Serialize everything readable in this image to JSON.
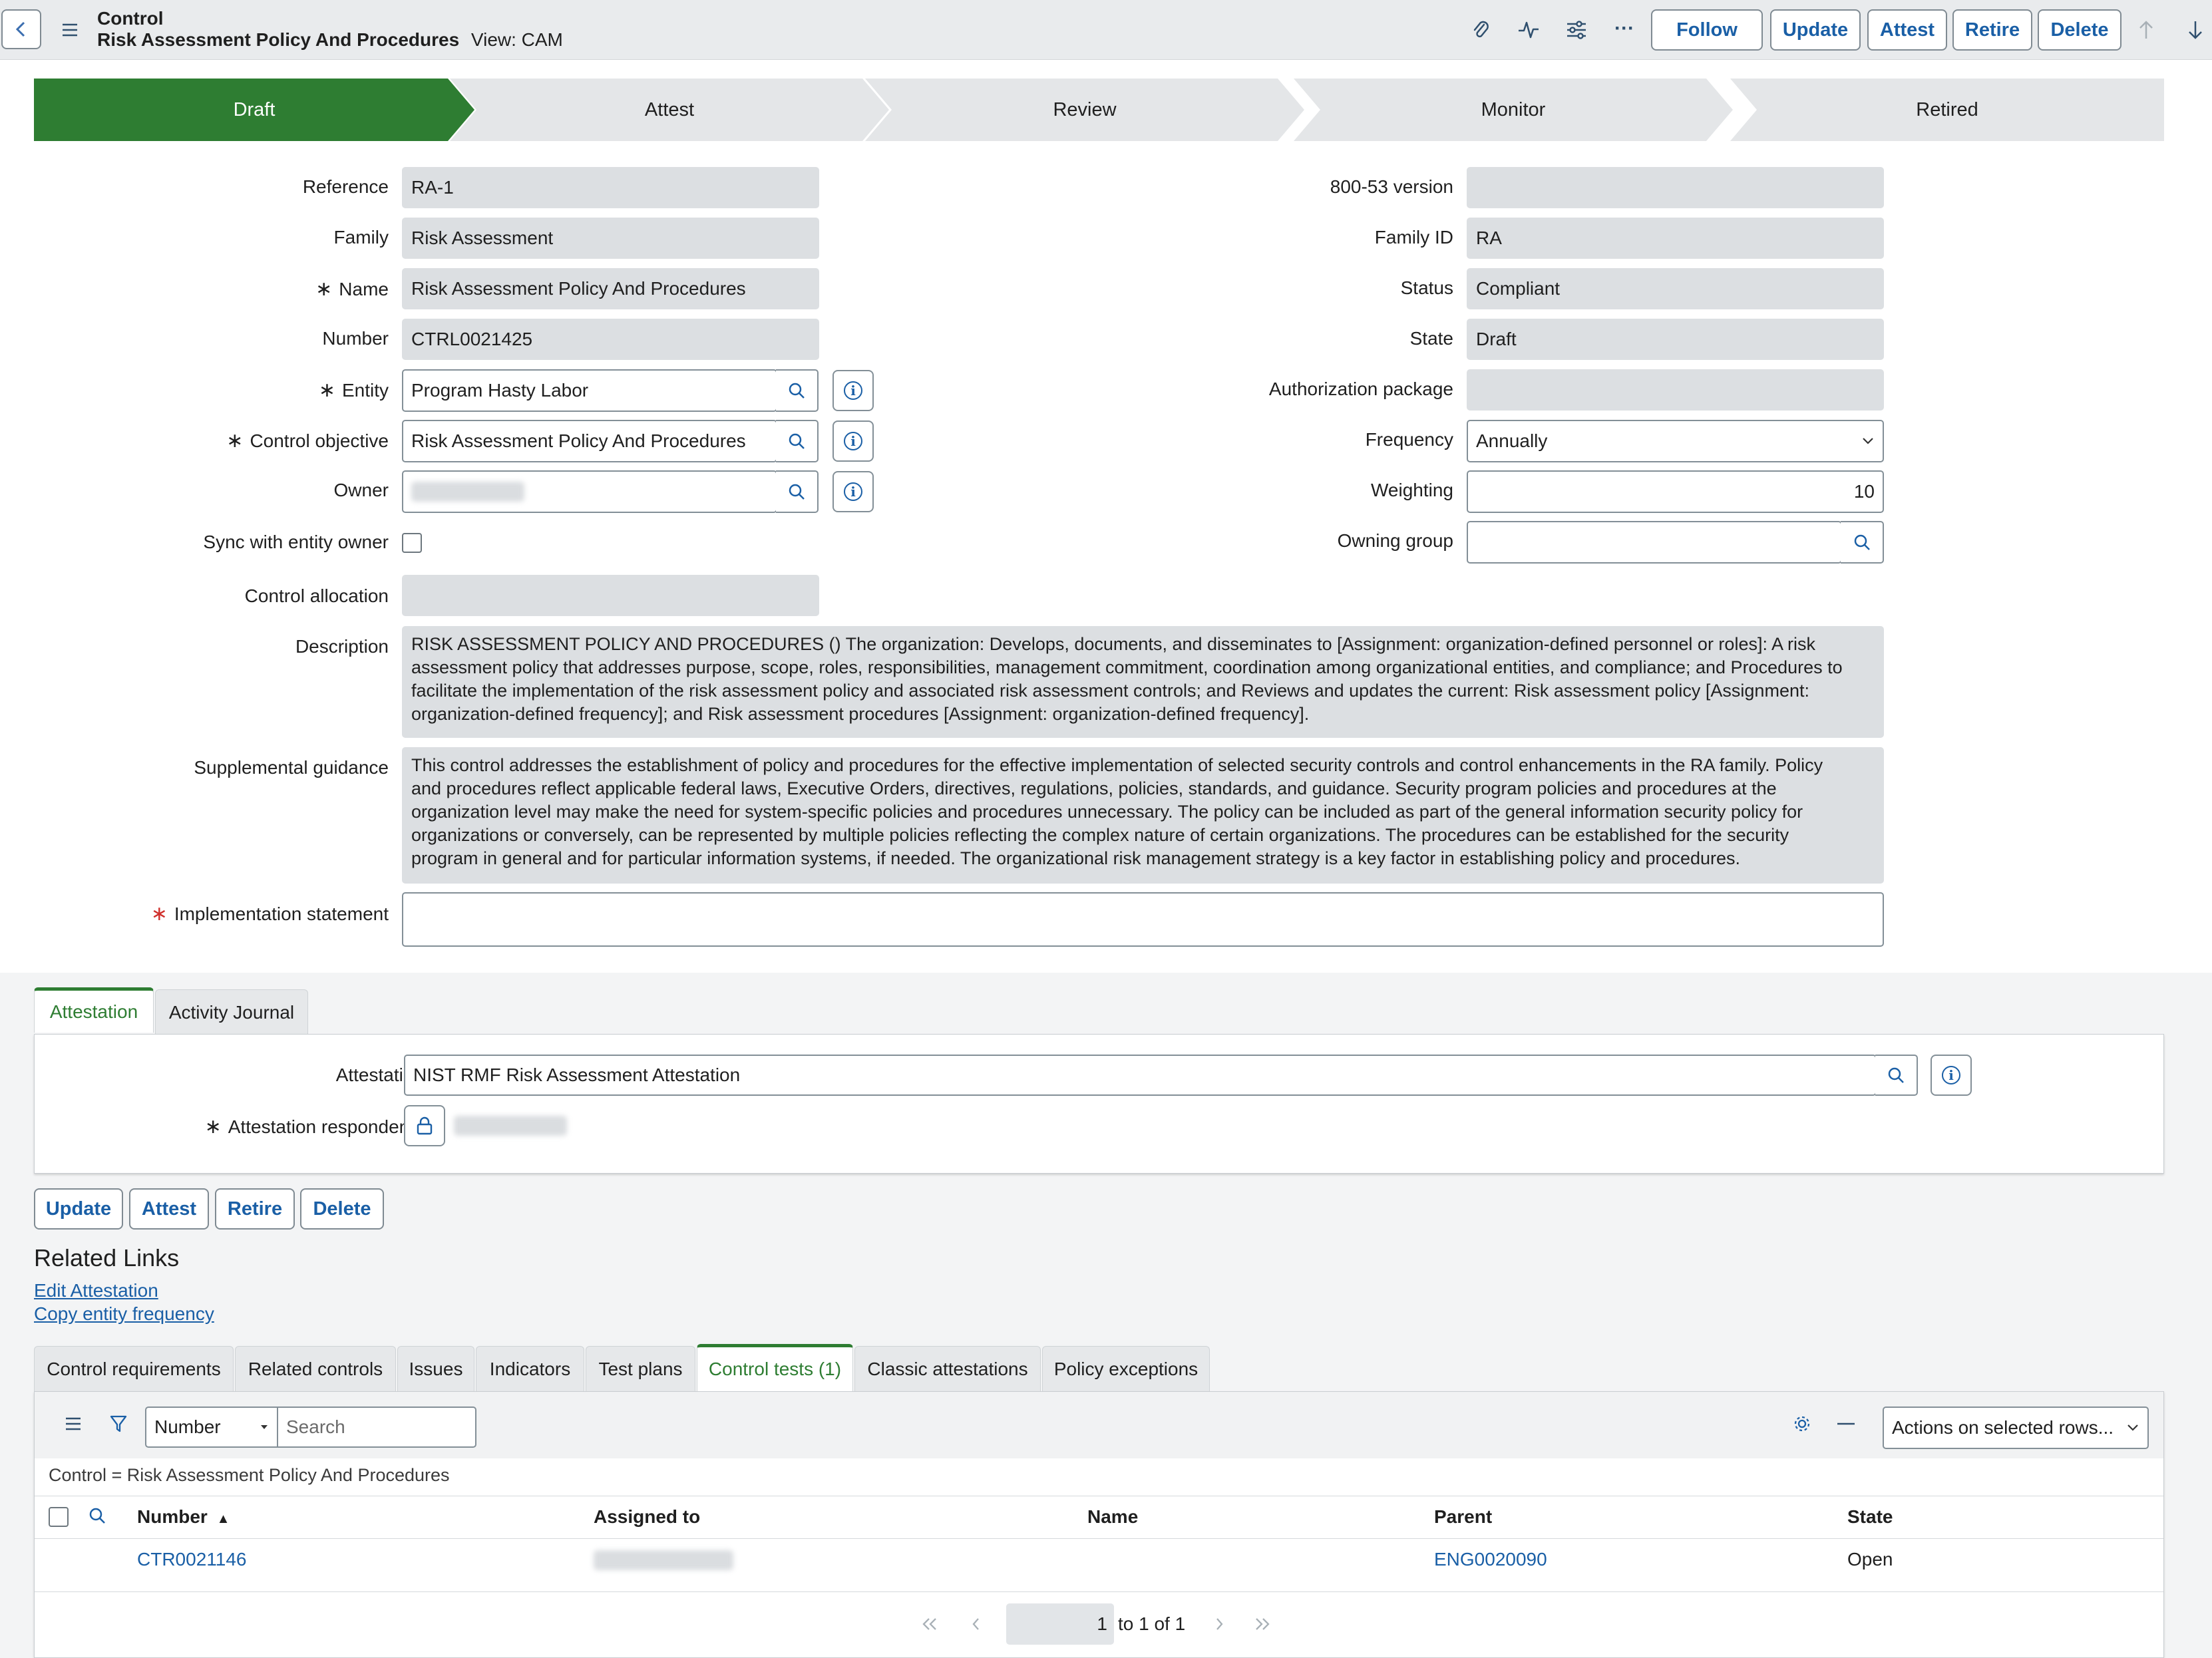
{
  "header": {
    "title": "Control",
    "record_name": "Risk Assessment Policy And Procedures",
    "view": "View: CAM",
    "buttons": {
      "follow": "Follow",
      "update": "Update",
      "attest": "Attest",
      "retire": "Retire",
      "delete": "Delete"
    },
    "more": "···"
  },
  "progress": {
    "stages": [
      "Draft",
      "Attest",
      "Review",
      "Monitor",
      "Retired"
    ],
    "active": "Draft",
    "active_color": "#2e7d32"
  },
  "form": {
    "reference": {
      "label": "Reference",
      "value": "RA-1"
    },
    "family": {
      "label": "Family",
      "value": "Risk Assessment"
    },
    "name": {
      "label": "Name",
      "value": "Risk Assessment Policy And Procedures"
    },
    "number": {
      "label": "Number",
      "value": "CTRL0021425"
    },
    "entity": {
      "label": "Entity",
      "value": "Program Hasty Labor"
    },
    "control_objective": {
      "label": "Control objective",
      "value": "Risk Assessment Policy And Procedures"
    },
    "owner": {
      "label": "Owner",
      "value": ""
    },
    "sync_owner": {
      "label": "Sync with entity owner",
      "checked": false
    },
    "control_allocation": {
      "label": "Control allocation",
      "value": ""
    },
    "version_80053": {
      "label": "800-53 version",
      "value": ""
    },
    "family_id": {
      "label": "Family ID",
      "value": "RA"
    },
    "status": {
      "label": "Status",
      "value": "Compliant"
    },
    "state": {
      "label": "State",
      "value": "Draft"
    },
    "authorization_package": {
      "label": "Authorization package",
      "value": ""
    },
    "frequency": {
      "label": "Frequency",
      "value": "Annually"
    },
    "weighting": {
      "label": "Weighting",
      "value": "10"
    },
    "owning_group": {
      "label": "Owning group",
      "value": ""
    },
    "description": {
      "label": "Description",
      "lines": [
        "RISK ASSESSMENT POLICY AND PROCEDURES () The organization: Develops, documents, and disseminates to [Assignment: organization-defined personnel or roles]: A risk",
        "assessment policy that addresses purpose, scope, roles, responsibilities, management commitment, coordination among organizational entities, and compliance; and Procedures to",
        "facilitate the implementation of the risk assessment policy and associated risk assessment controls; and Reviews and updates the current: Risk assessment policy [Assignment:",
        "organization-defined frequency]; and Risk assessment procedures [Assignment: organization-defined frequency]."
      ]
    },
    "supplemental_guidance": {
      "label": "Supplemental guidance",
      "lines": [
        "This control addresses the establishment of policy and procedures for the effective implementation of selected security controls and control enhancements in the RA family. Policy",
        "and procedures reflect applicable federal laws, Executive Orders, directives, regulations, policies, standards, and guidance. Security program policies and procedures at the",
        "organization level may make the need for system-specific policies and procedures unnecessary. The policy can be included as part of the general information security policy for",
        "organizations or conversely, can be represented by multiple policies reflecting the complex nature of certain organizations. The procedures can be established for the security",
        "program in general and for particular information systems, if needed. The organizational risk management strategy is a key factor in establishing policy and procedures."
      ]
    },
    "implementation_statement": {
      "label": "Implementation statement",
      "value": ""
    },
    "required_mark": "∗",
    "required_color": "#d0312d"
  },
  "section_tabs": [
    "Attestation",
    "Activity Journal"
  ],
  "attestation": {
    "attestation": {
      "label": "Attestation",
      "value": "NIST RMF Risk Assessment Attestation"
    },
    "respondents": {
      "label": "Attestation respondents",
      "value": ""
    }
  },
  "bottom_buttons": {
    "update": "Update",
    "attest": "Attest",
    "retire": "Retire",
    "delete": "Delete"
  },
  "related_links": {
    "title": "Related Links",
    "links": [
      "Edit Attestation",
      "Copy entity frequency"
    ]
  },
  "related_tabs": [
    "Control requirements",
    "Related controls",
    "Issues",
    "Indicators",
    "Test plans",
    "Control tests (1)",
    "Classic attestations",
    "Policy exceptions"
  ],
  "related_tabs_active": "Control tests (1)",
  "list": {
    "search_field": "Number",
    "search_placeholder": "Search",
    "actions": "Actions on selected rows...",
    "breadcrumb": "Control = Risk Assessment Policy And Procedures",
    "columns": [
      "Number",
      "Assigned to",
      "Name",
      "Parent",
      "State"
    ],
    "sort_indicator": "▲",
    "rows": [
      {
        "number": "CTR0021146",
        "assigned_to": "",
        "name": "",
        "parent": "ENG0020090",
        "state": "Open"
      }
    ],
    "pagination": {
      "page": "1",
      "range_text": "to 1 of 1"
    }
  },
  "colors": {
    "link": "#1a5fa6",
    "accent_green": "#2e7d32",
    "header_bg": "#e9ebed"
  }
}
